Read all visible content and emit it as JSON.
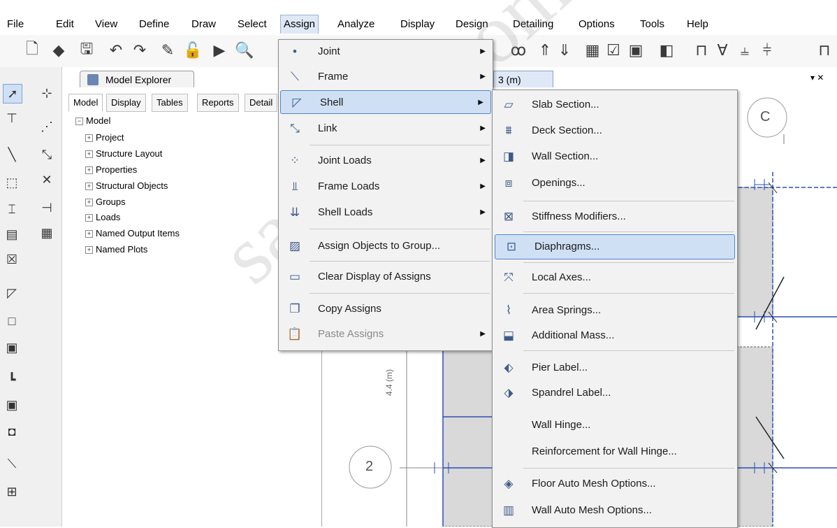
{
  "menubar": {
    "items": [
      "File",
      "Edit",
      "View",
      "Define",
      "Draw",
      "Select",
      "Assign",
      "Analyze",
      "Display",
      "Design",
      "Detailing",
      "Options",
      "Tools",
      "Help"
    ],
    "active": "Assign"
  },
  "explorer": {
    "title": "Model Explorer",
    "tabs": [
      "Model",
      "Display",
      "Tables",
      "Reports",
      "Detail"
    ],
    "tree_root": "Model",
    "tree_items": [
      "Project",
      "Structure Layout",
      "Properties",
      "Structural Objects",
      "Groups",
      "Loads",
      "Named Output Items",
      "Named Plots"
    ]
  },
  "drawing": {
    "tab_label": "3 (m)",
    "grid_bubble_c": "C",
    "grid_bubble_2": "2",
    "dimension_text": "4.4 (m)"
  },
  "assign_menu": {
    "items": [
      {
        "label": "Joint",
        "icon": "joint-icon",
        "submenu": true
      },
      {
        "label": "Frame",
        "icon": "frame-icon",
        "submenu": true
      },
      {
        "label": "Shell",
        "icon": "shell-icon",
        "submenu": true,
        "highlight": true
      },
      {
        "label": "Link",
        "icon": "link-icon",
        "submenu": true
      },
      {
        "label": "Joint Loads",
        "icon": "joint-loads-icon",
        "submenu": true
      },
      {
        "label": "Frame Loads",
        "icon": "frame-loads-icon",
        "submenu": true
      },
      {
        "label": "Shell Loads",
        "icon": "shell-loads-icon",
        "submenu": true
      },
      {
        "label": "Assign Objects to Group...",
        "icon": "group-icon",
        "submenu": false
      },
      {
        "label": "Clear Display of Assigns",
        "icon": "clear-icon",
        "submenu": false
      },
      {
        "label": "Copy Assigns",
        "icon": "copy-icon",
        "submenu": false
      },
      {
        "label": "Paste Assigns",
        "icon": "paste-icon",
        "submenu": true,
        "disabled": true
      }
    ]
  },
  "shell_menu": {
    "items": [
      {
        "label": "Slab Section...",
        "icon": "slab-icon"
      },
      {
        "label": "Deck Section...",
        "icon": "deck-icon"
      },
      {
        "label": "Wall Section...",
        "icon": "wall-icon"
      },
      {
        "label": "Openings...",
        "icon": "openings-icon"
      },
      {
        "label": "Stiffness Modifiers...",
        "icon": "stiffness-icon"
      },
      {
        "label": "Diaphragms...",
        "icon": "diaphragm-icon",
        "highlight": true
      },
      {
        "label": "Local Axes...",
        "icon": "local-axes-icon"
      },
      {
        "label": "Area Springs...",
        "icon": "springs-icon"
      },
      {
        "label": "Additional Mass...",
        "icon": "mass-icon"
      },
      {
        "label": "Pier Label...",
        "icon": "pier-icon"
      },
      {
        "label": "Spandrel Label...",
        "icon": "spandrel-icon"
      },
      {
        "label": "Wall Hinge...",
        "icon": ""
      },
      {
        "label": "Reinforcement for Wall Hinge...",
        "icon": ""
      },
      {
        "label": "Floor Auto Mesh Options...",
        "icon": "floor-mesh-icon"
      },
      {
        "label": "Wall Auto Mesh Options...",
        "icon": "wall-mesh-icon"
      }
    ]
  },
  "watermark": "saze118.com",
  "colors": {
    "highlight_bg": "#cfe0f5",
    "highlight_border": "#4f87c7",
    "grid_line": "#2b4fb8",
    "hatch": "#d9d9d9"
  }
}
